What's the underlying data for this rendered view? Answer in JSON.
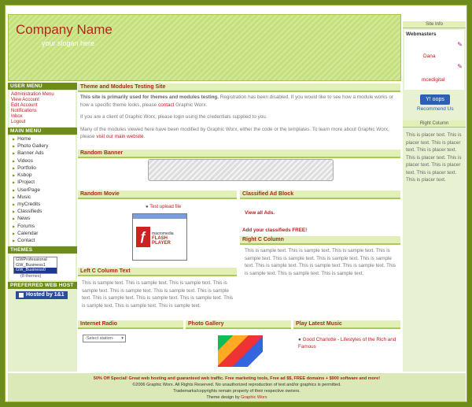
{
  "header": {
    "company": "Company Name",
    "slogan": "your slogan here"
  },
  "left": {
    "user_menu_title": "USER MENU",
    "user_links": [
      "Administration Menu",
      "View Account",
      "Edit Account",
      "Notifications",
      "Inbox",
      "Logout"
    ],
    "main_menu_title": "MAIN MENU",
    "main_links": [
      "Home",
      "Photo Gallery",
      "Banner Ads",
      "Videos",
      "Portfolio",
      "Ksbop",
      "IProject",
      "UserPage",
      "Music",
      "myCredits",
      "Classifieds",
      "News",
      "Forums",
      "Calendar",
      "Contact"
    ],
    "themes_title": "THEMES",
    "themes": [
      "GWProfessional",
      "GW_Business1",
      "GW_Business0"
    ],
    "themes_count": "(8 themes)",
    "host_title": "PREFERRED WEB HOST",
    "host_label": "Hosted by 1&1"
  },
  "main": {
    "testing_title": "Theme and Modules Testing Site",
    "p1_bold": "This site is primarily used for themes and modules testing.",
    "p1_rest": " Registration has been disabled. If you would like to see how a module works or how a specific theme looks, please ",
    "p1_link": "contact",
    "p1_end": " Graphic Worx.",
    "p2": "If you are a client of Graphic Worx, please login using the credentials supplied to you.",
    "p3": "Many of the modules viewed here have been modified by Graphic Worx, either the code or the templates. To learn more about Graphic Worx, please ",
    "p3_link": "visit our main website",
    "banner_title": "Random Banner",
    "movie_title": "Random Movie",
    "movie_link": "Test upload file",
    "flash_brand": "macromedia",
    "flash_name": "FLASH PLAYER",
    "classified_title": "Classified Ad Block",
    "classified_view": "View all Ads.",
    "classified_add": "Add your classifieds FREE!",
    "rightc_title": "Right C Column",
    "rightc_text": "This is sample text. This is sample text. This is sample text. This is sample text. This is sample text. This is sample text. This is sample text. This is sample text. This is sample text. This is sample text. This is sample text. This is sample text. This is sample text.",
    "leftc_title": "Left C Column Text",
    "leftc_text": "This is sample text. This is sample text. This is sample text. This is sample text. This is sample text. This is sample text. This is sample text. This is sample text. This is sample text. This is sample text. This is sample text. This is sample text. This is sample text.",
    "radio_title": "Internet Radio",
    "radio_select": "-Select station-",
    "gallery_title": "Photo Gallery",
    "music_title": "Play Latest Music",
    "music_item": "Good Charlotte - Lifestyles of the Rich and Famous"
  },
  "right": {
    "siteinfo_title": "Site Info",
    "webmasters": "Webmasters",
    "wm1": "Dana",
    "wm2": "mcedigital",
    "yahoo": "Y! oops",
    "recommend": "Recommend Us",
    "rcol_title": "Right Column",
    "rcol_text": "This is placer text. This is placer text. This is placer text. This is placer text. This is placer text. This is placer text. This is placer text. This is placer text. This is placer text."
  },
  "footer": {
    "promo": "50% Off Special! Great web hosting and guaranteed web traffic. Free marketing tools, Free ad $$, FREE domains + $900 software and more!",
    "copyright": "©2006 Graphic Worx. All Rights Reserved. No unauthorized reproduction of text and/or graphics is permitted.",
    "trademarks": "Trademarks/copyrights remain property of their respective owners.",
    "design_prefix": "Theme design by ",
    "design_link": "Graphic Worx"
  }
}
